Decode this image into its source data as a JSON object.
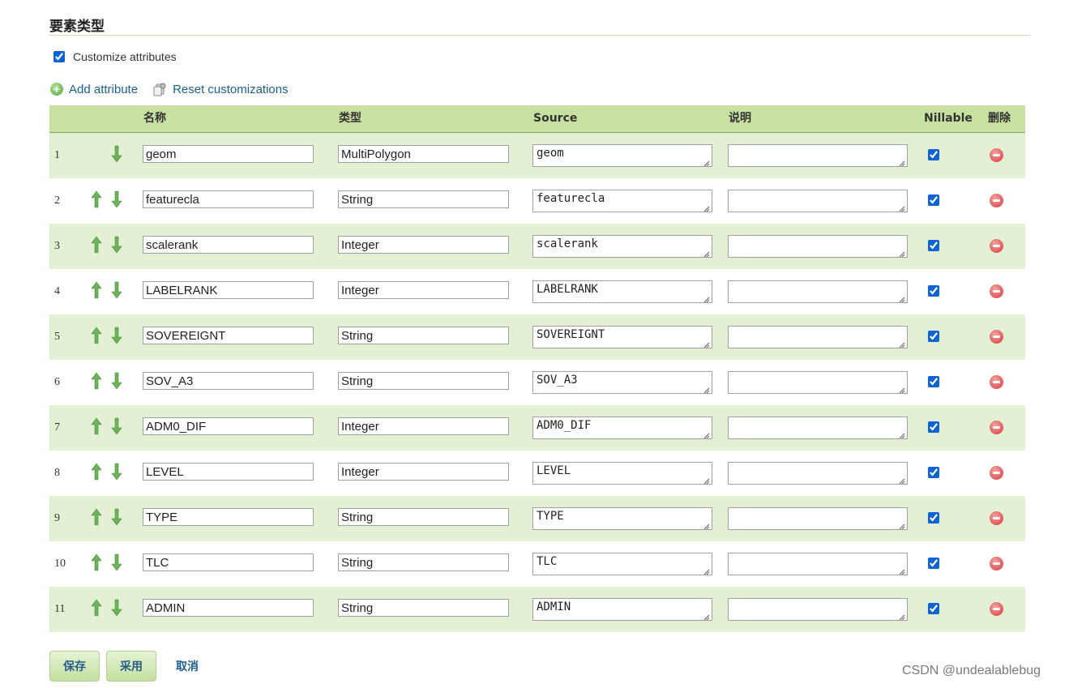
{
  "section": {
    "title": "要素类型"
  },
  "customize": {
    "label": "Customize attributes",
    "checked": true
  },
  "actions": {
    "add_label": "Add attribute",
    "reset_label": "Reset customizations"
  },
  "columns": {
    "name": "名称",
    "type": "类型",
    "source": "Source",
    "description": "说明",
    "nillable": "Nillable",
    "delete": "删除"
  },
  "attributes": [
    {
      "index": "1",
      "name": "geom",
      "type": "MultiPolygon",
      "source": "geom",
      "description": "",
      "nillable": true
    },
    {
      "index": "2",
      "name": "featurecla",
      "type": "String",
      "source": "featurecla",
      "description": "",
      "nillable": true
    },
    {
      "index": "3",
      "name": "scalerank",
      "type": "Integer",
      "source": "scalerank",
      "description": "",
      "nillable": true
    },
    {
      "index": "4",
      "name": "LABELRANK",
      "type": "Integer",
      "source": "LABELRANK",
      "description": "",
      "nillable": true
    },
    {
      "index": "5",
      "name": "SOVEREIGNT",
      "type": "String",
      "source": "SOVEREIGNT",
      "description": "",
      "nillable": true
    },
    {
      "index": "6",
      "name": "SOV_A3",
      "type": "String",
      "source": "SOV_A3",
      "description": "",
      "nillable": true
    },
    {
      "index": "7",
      "name": "ADM0_DIF",
      "type": "Integer",
      "source": "ADM0_DIF",
      "description": "",
      "nillable": true
    },
    {
      "index": "8",
      "name": "LEVEL",
      "type": "Integer",
      "source": "LEVEL",
      "description": "",
      "nillable": true
    },
    {
      "index": "9",
      "name": "TYPE",
      "type": "String",
      "source": "TYPE",
      "description": "",
      "nillable": true
    },
    {
      "index": "10",
      "name": "TLC",
      "type": "String",
      "source": "TLC",
      "description": "",
      "nillable": true
    },
    {
      "index": "11",
      "name": "ADMIN",
      "type": "String",
      "source": "ADMIN",
      "description": "",
      "nillable": true
    }
  ],
  "buttons": {
    "save": "保存",
    "apply": "采用",
    "cancel": "取消"
  },
  "watermark": "CSDN @undealablebug",
  "colors": {
    "header_bg": "#c8e0a0",
    "row_alt_bg": "#e3f0d4",
    "link": "#1b5f8f",
    "arrow": "#6cb35a",
    "delete": "#d63a3a"
  },
  "icons": {
    "add": "add-circle-icon",
    "reset": "reset-icon",
    "up": "arrow-up-icon",
    "down": "arrow-down-icon",
    "delete": "delete-circle-icon"
  }
}
